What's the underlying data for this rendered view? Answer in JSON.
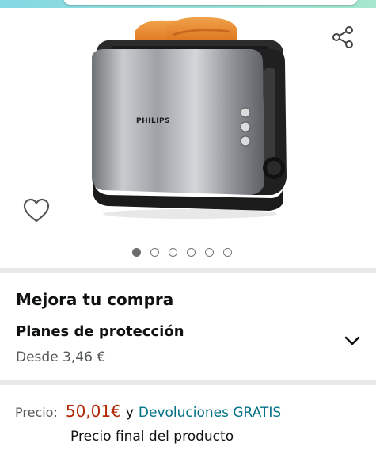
{
  "product": {
    "brand_label": "PHILIPS",
    "image_count": 6,
    "active_image": 1
  },
  "upgrade": {
    "title": "Mejora tu compra",
    "plan_title": "Planes de protección",
    "plan_from": "Desde 3,46 €"
  },
  "pricing": {
    "label": "Precio:",
    "value": "50,01€",
    "conjunction": "y",
    "returns_link": "Devoluciones GRATIS",
    "final_note": "Precio final del producto"
  },
  "icons": {
    "share": "share-icon",
    "wishlist": "heart-icon",
    "expand": "chevron-down-icon"
  },
  "colors": {
    "price": "#b12704",
    "link": "#007185",
    "header_gradient_start": "#84d8e3",
    "header_gradient_end": "#a6e7ce"
  }
}
